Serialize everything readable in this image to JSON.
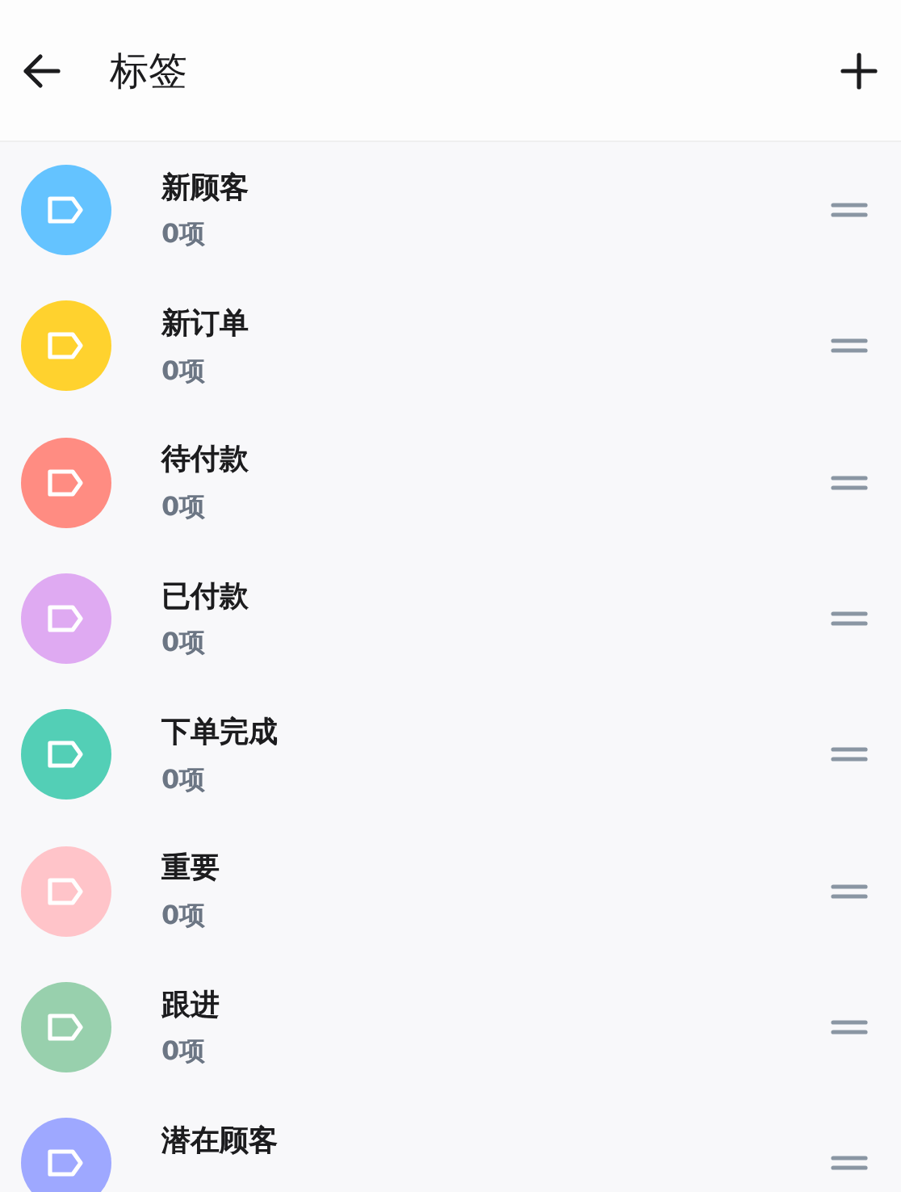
{
  "header": {
    "title": "标签"
  },
  "tags": [
    {
      "name": "新顾客",
      "count": "0项",
      "color": "#64c3ff"
    },
    {
      "name": "新订单",
      "count": "0项",
      "color": "#ffd22e"
    },
    {
      "name": "待付款",
      "count": "0项",
      "color": "#ff8c82"
    },
    {
      "name": "已付款",
      "count": "0项",
      "color": "#dfaaf2"
    },
    {
      "name": "下单完成",
      "count": "0项",
      "color": "#53cfb6"
    },
    {
      "name": "重要",
      "count": "0项",
      "color": "#ffc4c9"
    },
    {
      "name": "跟进",
      "count": "0项",
      "color": "#98d0ad"
    },
    {
      "name": "潜在顾客",
      "color": "#9ea8ff"
    }
  ]
}
